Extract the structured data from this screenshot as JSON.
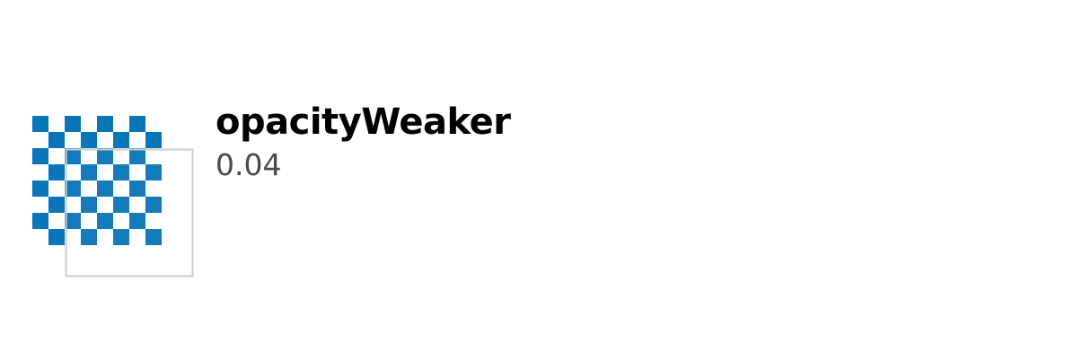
{
  "token": {
    "name": "opacityWeaker",
    "value": "0.04"
  },
  "swatch": {
    "checker_color": "#0A76B9",
    "overlay_border_color": "#CCCCCC",
    "background_color": "#FFFFFF"
  }
}
